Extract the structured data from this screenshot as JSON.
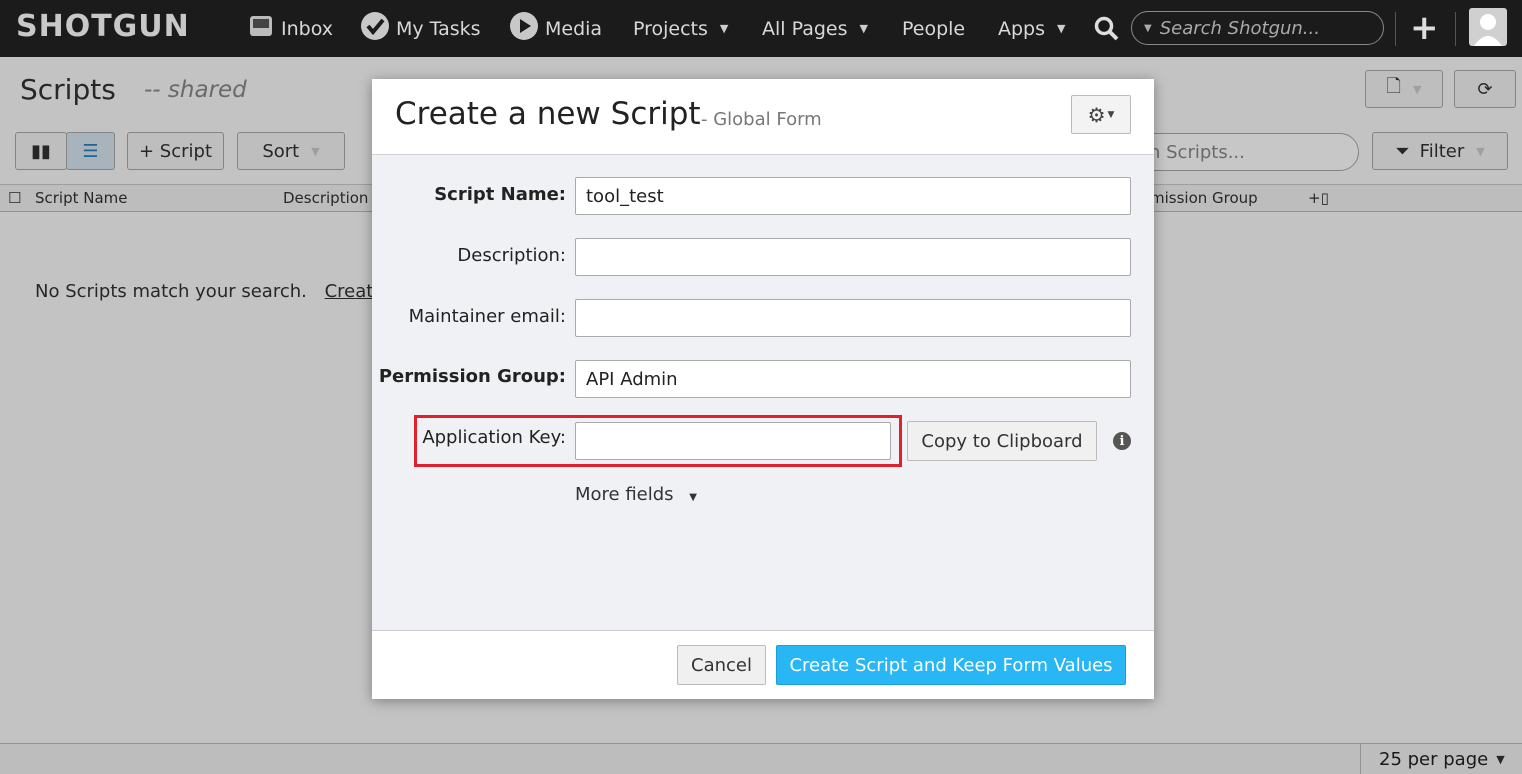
{
  "nav": {
    "logo": "SHOTGUN",
    "inbox": "Inbox",
    "my_tasks": "My Tasks",
    "media": "Media",
    "projects": "Projects",
    "all_pages": "All Pages",
    "people": "People",
    "apps": "Apps",
    "search_placeholder": "Search Shotgun..."
  },
  "page": {
    "title": "Scripts",
    "subtitle": "-- shared",
    "add_button": "+ Script",
    "sort_button": "Sort",
    "search_placeholder": "h Scripts...",
    "filter_button": "Filter",
    "columns": [
      "Script Name",
      "Description",
      "mission Group"
    ],
    "empty_message": "No Scripts match your search.",
    "empty_link": "Create",
    "per_page": "25 per page"
  },
  "modal": {
    "title": "Create a new Script",
    "subtitle": "- Global Form",
    "fields": {
      "script_name_label": "Script Name:",
      "script_name_value": "tool_test",
      "description_label": "Description:",
      "description_value": "",
      "maintainer_label": "Maintainer email:",
      "maintainer_value": "",
      "permission_label": "Permission Group:",
      "permission_value": "API Admin",
      "app_key_label": "Application Key:",
      "app_key_value": ""
    },
    "copy_button": "Copy to Clipboard",
    "more_fields": "More fields",
    "cancel_button": "Cancel",
    "create_button": "Create Script and Keep Form Values"
  },
  "colors": {
    "nav_bg": "#1b1b1b",
    "primary_button": "#28b6f5",
    "highlight_border": "#e0202a"
  }
}
